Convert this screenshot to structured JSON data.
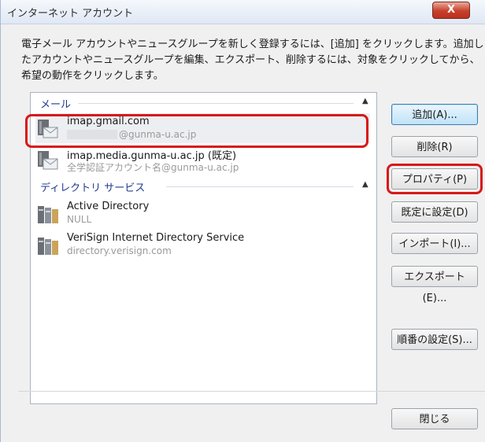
{
  "window": {
    "title": "インターネット アカウント",
    "close_glyph": "X"
  },
  "description": "電子メール アカウントやニュースグループを新しく登録するには、[追加] をクリックします。追加したアカウントやニュースグループを編集、エクスポート、削除するには、対象をクリックしてから、希望の動作をクリックします。",
  "groups": {
    "mail": {
      "label": "メール",
      "accounts": [
        {
          "title": "imap.gmail.com",
          "subtitle": "@gunma-u.ac.jp"
        },
        {
          "title": "imap.media.gunma-u.ac.jp (既定)",
          "subtitle": "全学認証アカウント名@gunma-u.ac.jp"
        }
      ]
    },
    "directory": {
      "label": "ディレクトリ サービス",
      "accounts": [
        {
          "title": "Active Directory",
          "subtitle": "NULL"
        },
        {
          "title": "VeriSign Internet Directory Service",
          "subtitle": "directory.verisign.com"
        }
      ]
    }
  },
  "buttons": {
    "add": "追加(A)...",
    "delete": "削除(R)",
    "properties": "プロパティ(P)",
    "set_default": "既定に設定(D)",
    "import": "インポート(I)...",
    "export": "エクスポート(E)...",
    "order": "順番の設定(S)...",
    "close": "閉じる"
  },
  "colors": {
    "highlight": "#d81818",
    "group_header": "#1f3a93"
  },
  "icons": {
    "mail_account": "mail-account-icon",
    "directory_service": "directory-service-icon",
    "chevron": "chevron-up-icon"
  }
}
